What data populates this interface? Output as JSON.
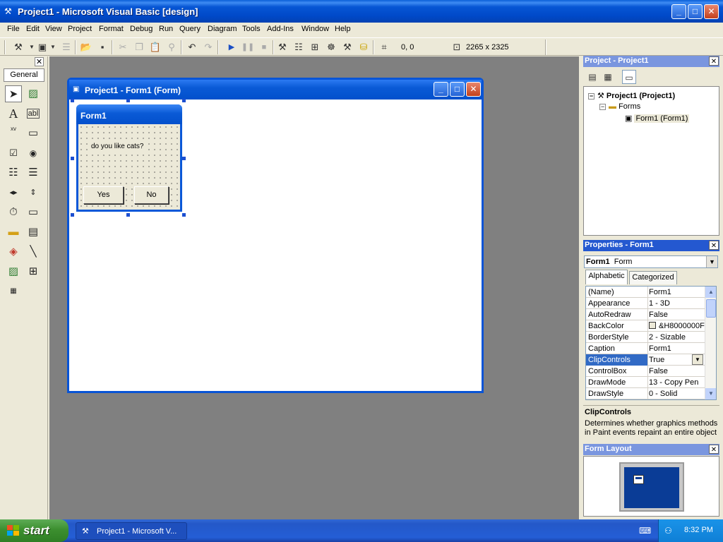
{
  "window": {
    "title": "Project1 - Microsoft Visual Basic [design]",
    "minimize": "_",
    "maximize": "□",
    "close": "✕"
  },
  "menu": [
    "File",
    "Edit",
    "View",
    "Project",
    "Format",
    "Debug",
    "Run",
    "Query",
    "Diagram",
    "Tools",
    "Add-Ins",
    "Window",
    "Help"
  ],
  "toolbar": {
    "position": "0, 0",
    "size": "2265 x 2325"
  },
  "toolbox": {
    "close": "✕",
    "tab_label": "General",
    "glyphs": {
      "text": "A",
      "textbox": "abl",
      "frame": "xv"
    }
  },
  "form_designer": {
    "title": "Project1 - Form1 (Form)",
    "form": {
      "caption": "Form1",
      "label": "do you like cats?",
      "yes_button": "Yes",
      "no_button": "No"
    }
  },
  "project_explorer": {
    "title": "Project - Project1",
    "root": "Project1 (Project1)",
    "folder": "Forms",
    "item": "Form1 (Form1)"
  },
  "properties": {
    "title": "Properties - Form1",
    "object_name": "Form1",
    "object_type": "Form",
    "tabs": [
      "Alphabetic",
      "Categorized"
    ],
    "rows": [
      {
        "name": "(Name)",
        "value": "Form1"
      },
      {
        "name": "Appearance",
        "value": "1 - 3D"
      },
      {
        "name": "AutoRedraw",
        "value": "False"
      },
      {
        "name": "BackColor",
        "value": "&H8000000F"
      },
      {
        "name": "BorderStyle",
        "value": "2 - Sizable"
      },
      {
        "name": "Caption",
        "value": "Form1"
      },
      {
        "name": "ClipControls",
        "value": "True"
      },
      {
        "name": "ControlBox",
        "value": "False"
      },
      {
        "name": "DrawMode",
        "value": "13 - Copy Pen"
      },
      {
        "name": "DrawStyle",
        "value": "0 - Solid"
      }
    ],
    "selected": "ClipControls",
    "description_title": "ClipControls",
    "description": "Determines whether graphics methods in Paint events repaint an entire object"
  },
  "form_layout": {
    "title": "Form Layout"
  },
  "taskbar": {
    "start": "start",
    "task": "Project1 - Microsoft V...",
    "clock": "8:32 PM"
  }
}
